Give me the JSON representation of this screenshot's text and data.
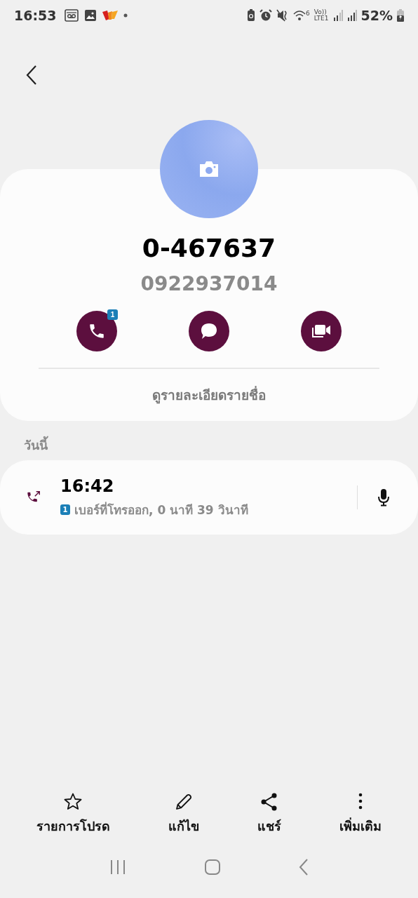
{
  "status_bar": {
    "time": "16:53",
    "wifi_band": "6",
    "volte": "Vo))",
    "lte": "LTE1",
    "battery": "52%"
  },
  "contact": {
    "name": "0-467637",
    "number": "0922937014"
  },
  "actions": [
    {
      "kind": "call",
      "badge": "1"
    },
    {
      "kind": "message"
    },
    {
      "kind": "video"
    }
  ],
  "details_link": "ดูรายละเอียดรายชื่อ",
  "section_title": "วันนี้",
  "call_log": [
    {
      "kind": "outgoing",
      "time": "16:42",
      "sim": "1",
      "description": "เบอร์ที่โทรออก, 0 นาที 39 วินาที",
      "recording": true
    }
  ],
  "bottom_actions": [
    {
      "kind": "favorite",
      "label": "รายการโปรด"
    },
    {
      "kind": "edit",
      "label": "แก้ไข"
    },
    {
      "kind": "share",
      "label": "แชร์"
    },
    {
      "kind": "more",
      "label": "เพิ่มเติม"
    }
  ]
}
